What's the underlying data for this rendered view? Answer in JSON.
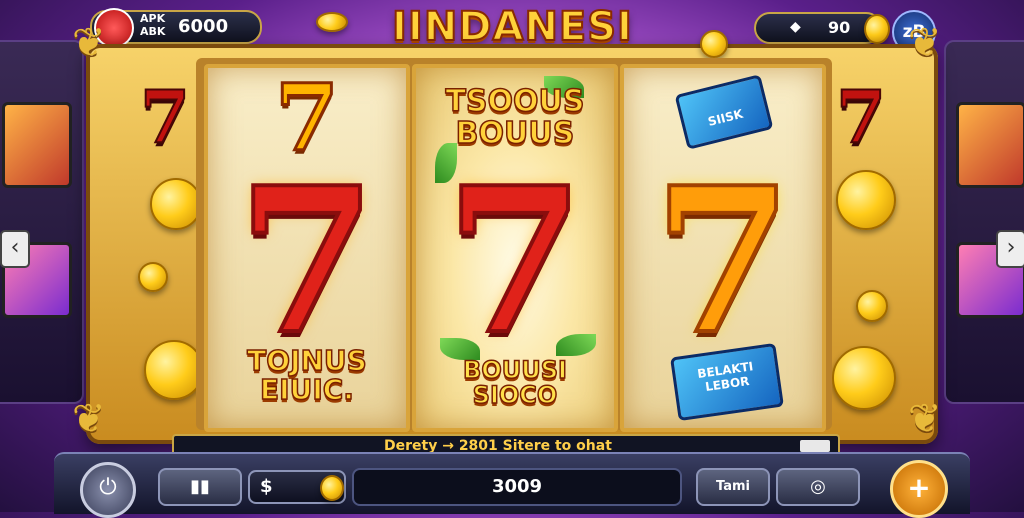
{
  "header": {
    "badge_line1": "APK",
    "badge_line2": "ABK",
    "badge_value": "6000",
    "logo_title": "IINDANESI",
    "coin_balance": "90",
    "profile_label": "zB"
  },
  "reels": [
    {
      "top": "7",
      "center": "7",
      "bottom": "TOJNUS\nEIUIC."
    },
    {
      "top": "TSOOUS\nBOUUS",
      "center": "7",
      "bottom": "BOUUSI\nSIOCO"
    },
    {
      "top": "SIISK",
      "center": "7",
      "bottom": "BELAKTI\nLEBOR"
    }
  ],
  "side_symbols": {
    "left": "7",
    "right": "7"
  },
  "message_bar": {
    "text": "Derety → 2801 Sitere to ohat"
  },
  "controls": {
    "bet_currency": "$",
    "total_value": "3009",
    "mode_label": "Tami"
  },
  "icons": [
    "power-icon",
    "pause-icon",
    "coin-icon",
    "target-icon",
    "plus-icon",
    "chevron-left-icon",
    "chevron-right-icon"
  ],
  "colors": {
    "accent_gold": "#ffd23a",
    "seven_red": "#e0221a",
    "panel_dark": "#12142a"
  }
}
